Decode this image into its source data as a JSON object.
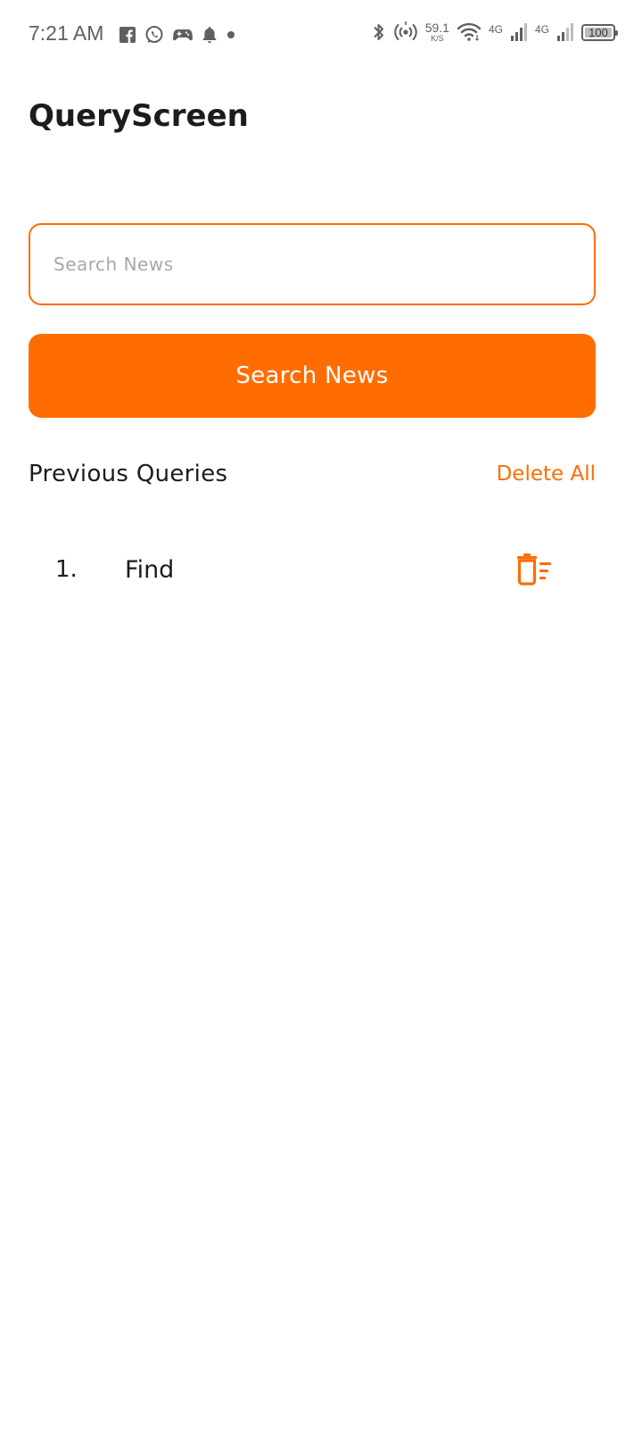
{
  "status_bar": {
    "time": "7:21 AM",
    "left_icons": [
      "facebook-icon",
      "whatsapp-icon",
      "game-controller-icon",
      "notification-bell-icon",
      "dot-icon"
    ],
    "network_speed_value": "59.1",
    "network_speed_unit": "K/S",
    "network_type_1": "4G",
    "network_type_2": "4G",
    "battery_level": "100",
    "icon_color": "#5f5f5f"
  },
  "header": {
    "title": "QueryScreen"
  },
  "search": {
    "placeholder": "Search News",
    "value": "",
    "button_label": "Search News"
  },
  "previous_queries": {
    "title": "Previous Queries",
    "delete_all_label": "Delete All",
    "items": [
      {
        "index": "1.",
        "text": "Find"
      }
    ]
  },
  "colors": {
    "accent": "#ff6d00",
    "text": "#1c1c1c",
    "placeholder": "#a8a8a8",
    "background": "#ffffff"
  }
}
